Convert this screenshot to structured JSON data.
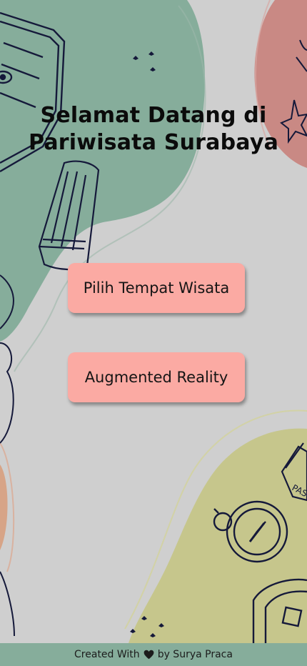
{
  "title_line1": "Selamat Datang di",
  "title_line2": "Pariwisata Surabaya",
  "buttons": {
    "pick_place": "Pilih Tempat Wisata",
    "ar": "Augmented Reality"
  },
  "footer": {
    "created_with": "Created With",
    "heart_icon": "heart-icon",
    "author": "by Surya Praca"
  },
  "colors": {
    "background": "#cfcfcf",
    "green_blob": "#86ad9b",
    "red_blob": "#c98984",
    "yellow_blob": "#c6c68c",
    "button": "#fbaaa3",
    "footer": "#86ad9b"
  }
}
